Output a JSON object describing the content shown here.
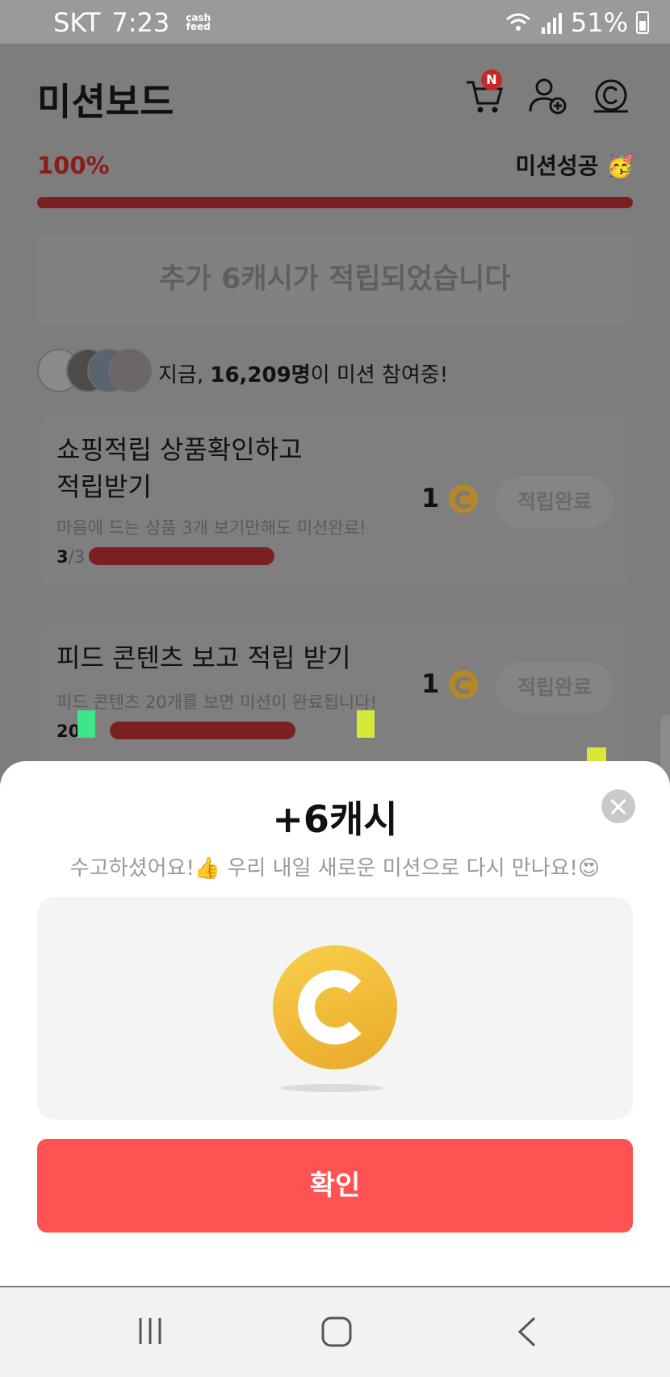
{
  "status": {
    "carrier": "SKT",
    "time": "7:23",
    "app_logo_top": "cash",
    "app_logo_bottom": "feed",
    "battery": "51%"
  },
  "header": {
    "title": "미션보드",
    "cart_badge": "N"
  },
  "progress": {
    "percent_label": "100%",
    "value": 1.0,
    "success_label": "미션성공 🥳"
  },
  "notice": "추가 6캐시가 적립되었습니다",
  "participants": {
    "prefix": "지금, ",
    "count": "16,209명",
    "suffix": "이 미션 참여중!"
  },
  "missions": [
    {
      "title_line1": "쇼핑적립 상품확인하고",
      "title_line2": "적립받기",
      "desc": "마음에 드는 상품 3개 보기만해도 미션완료!",
      "done": "3",
      "total": "/3",
      "reward": "1",
      "button": "적립완료"
    },
    {
      "title_line1": "피드 콘텐츠 보고 적립 받기",
      "desc": "피드 콘텐츠 20개를 보면 미션이 완료됩니다!",
      "done": "20",
      "total": "0",
      "reward": "1",
      "button": "적립완료"
    }
  ],
  "sheet": {
    "title": "+6캐시",
    "subtitle": "수고하셨어요!👍 우리 내일 새로운 미션으로 다시 만나요!😍",
    "confirm": "확인"
  },
  "colors": {
    "accent": "#ff5252",
    "coin": "#f2b93a"
  }
}
